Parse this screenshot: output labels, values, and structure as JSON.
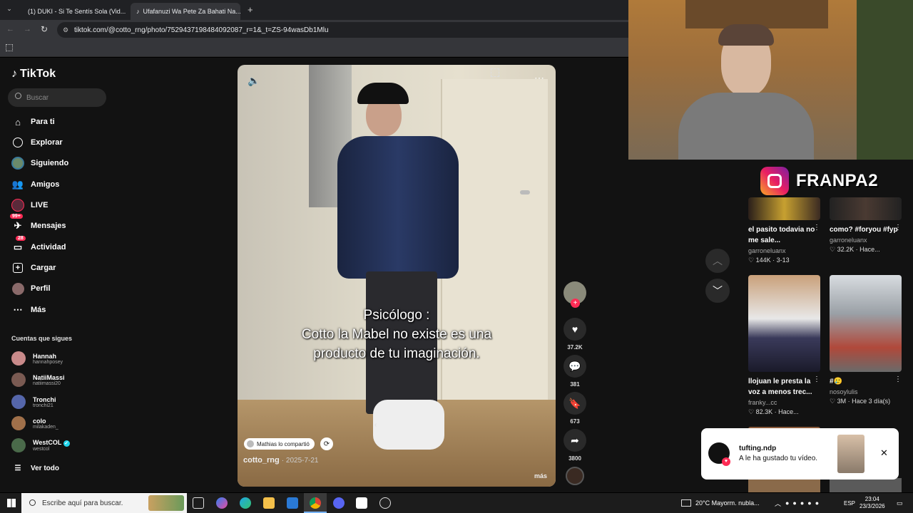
{
  "browser": {
    "tabs": [
      {
        "title": "(1) DUKI - Si Te Sentís Sola (Vid...",
        "icon": "youtube-icon",
        "active": false
      },
      {
        "title": "Ufafanuzi Wa Pete Za Bahati Na...",
        "icon": "tiktok-icon",
        "active": true
      }
    ],
    "new_tab": "+",
    "close": "✕",
    "url": "tiktok.com/@cotto_rng/photo/7529437198484092087_r=1&_t=ZS-94wasDb1Mlu"
  },
  "tiktok": {
    "logo": "TikTok",
    "search_placeholder": "Buscar",
    "nav": [
      {
        "label": "Para ti",
        "icon": "home-icon"
      },
      {
        "label": "Explorar",
        "icon": "compass-icon"
      },
      {
        "label": "Siguiendo",
        "icon": "following-icon"
      },
      {
        "label": "Amigos",
        "icon": "friends-icon"
      },
      {
        "label": "LIVE",
        "icon": "live-icon"
      },
      {
        "label": "Mensajes",
        "icon": "messages-icon",
        "badge": "99+"
      },
      {
        "label": "Actividad",
        "icon": "activity-icon",
        "badge": "28"
      },
      {
        "label": "Cargar",
        "icon": "upload-icon"
      },
      {
        "label": "Perfil",
        "icon": "profile-icon"
      },
      {
        "label": "Más",
        "icon": "more-icon"
      }
    ],
    "following_title": "Cuentas que sigues",
    "following": [
      {
        "name": "Hannah",
        "user": "hannahposey",
        "color": "#c98a8a"
      },
      {
        "name": "NatiiMassi",
        "user": "natiimassi20",
        "color": "#7a5a52"
      },
      {
        "name": "Tronchi",
        "user": "tronchi21",
        "color": "#5566aa"
      },
      {
        "name": "colo",
        "user": "milakaden_",
        "color": "#a0704a"
      },
      {
        "name": "WestCOL",
        "user": "westcol",
        "color": "#4a6a4a",
        "verified": true
      }
    ],
    "see_all": "Ver todo"
  },
  "video": {
    "caption": [
      "Psicólogo :",
      "Cotto la Mabel no existe es una",
      "producto de tu imaginación."
    ],
    "shared_by": "Mathias lo compartió",
    "author": "cotto_rng",
    "date": "2025-7-21",
    "more": "más",
    "actions": {
      "likes": "37.2K",
      "comments": "381",
      "saves": "673",
      "shares": "3800"
    }
  },
  "right_grid": [
    {
      "title": "el pasito todavia no me sale...",
      "author": "garroneluanx",
      "stats": "♡ 144K · 3-13"
    },
    {
      "title": "como? #foryou #fyp",
      "author": "garroneluanx",
      "stats": "♡ 32.2K · Hace..."
    },
    {
      "title": "llojuan le presta la voz a menos trec...",
      "author": "franky...cc",
      "stats": "♡ 82.3K · Hace..."
    },
    {
      "title": "#🥲",
      "author": "nosoylulis",
      "stats": "♡ 3M · Hace 3 día(s)"
    }
  ],
  "overlay": {
    "instagram_handle": "FRANPA2"
  },
  "notification": {
    "user": "tufting.ndp",
    "message": "A le ha gustado tu vídeo.",
    "close": "✕"
  },
  "taskbar": {
    "search_placeholder": "Escribe aquí para buscar.",
    "weather": "20°C  Mayorm. nubla...",
    "lang": "ESP",
    "time": "23:04",
    "date": "23/3/2026"
  }
}
